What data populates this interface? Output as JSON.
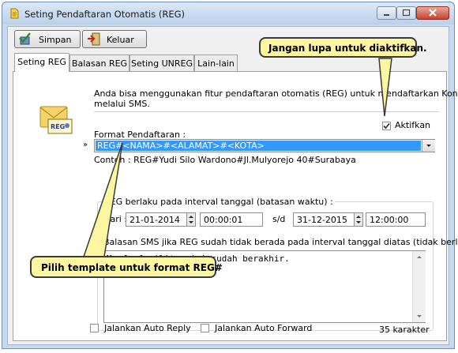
{
  "window": {
    "title": "Seting Pendaftaran Otomatis (REG)"
  },
  "toolbar": {
    "simpan_label": "Simpan",
    "keluar_label": "Keluar"
  },
  "tabs": [
    {
      "label": "Seting REG",
      "active": true
    },
    {
      "label": "Balasan REG",
      "active": false
    },
    {
      "label": "Seting UNREG",
      "active": false
    },
    {
      "label": "Lain-lain",
      "active": false
    }
  ],
  "reg": {
    "description_line1": "Anda bisa menggunakan fitur pendaftaran otomatis (REG) untuk mendaftarkan Kontak",
    "description_line2": "melalui SMS.",
    "aktifkan_label": "Aktifkan",
    "aktifkan_checked": true,
    "format_label": "Format Pendaftaran :",
    "format_value": "REG#<NAMA>#<ALAMAT>#<KOTA>",
    "format_marker": "»",
    "example_text": "Contoh : REG#Yudi Silo Wardono#Jl.Mulyorejo 40#Surabaya",
    "icon_badge": "REG",
    "interval": {
      "group_label": "REG berlaku pada interval tanggal (batasan waktu) :",
      "dari_label": "Dari :",
      "sd_label": "s/d",
      "start_date": "21-01-2014",
      "start_time": "00:00:01",
      "end_date": "31-12-2015",
      "end_time": "12:00:00",
      "reply_label": "Balasan SMS jika REG sudah tidak berada pada interval tanggal diatas (tidak berlaku)",
      "reply_text": "Maaf, fasilitas ini sudah berakhir.",
      "char_count": "35 karakter"
    },
    "auto_reply_label": "Jalankan Auto Reply",
    "auto_forward_label": "Jalankan Auto Forward"
  },
  "callouts": {
    "top": "Jangan lupa untuk diaktifkan.",
    "bottom": "Pilih template untuk format REG#"
  },
  "colors": {
    "selection": "#3399ff",
    "callout_bg": "#fdf6a0",
    "titlebar": "#c7d9ef",
    "close": "#c9432c"
  }
}
